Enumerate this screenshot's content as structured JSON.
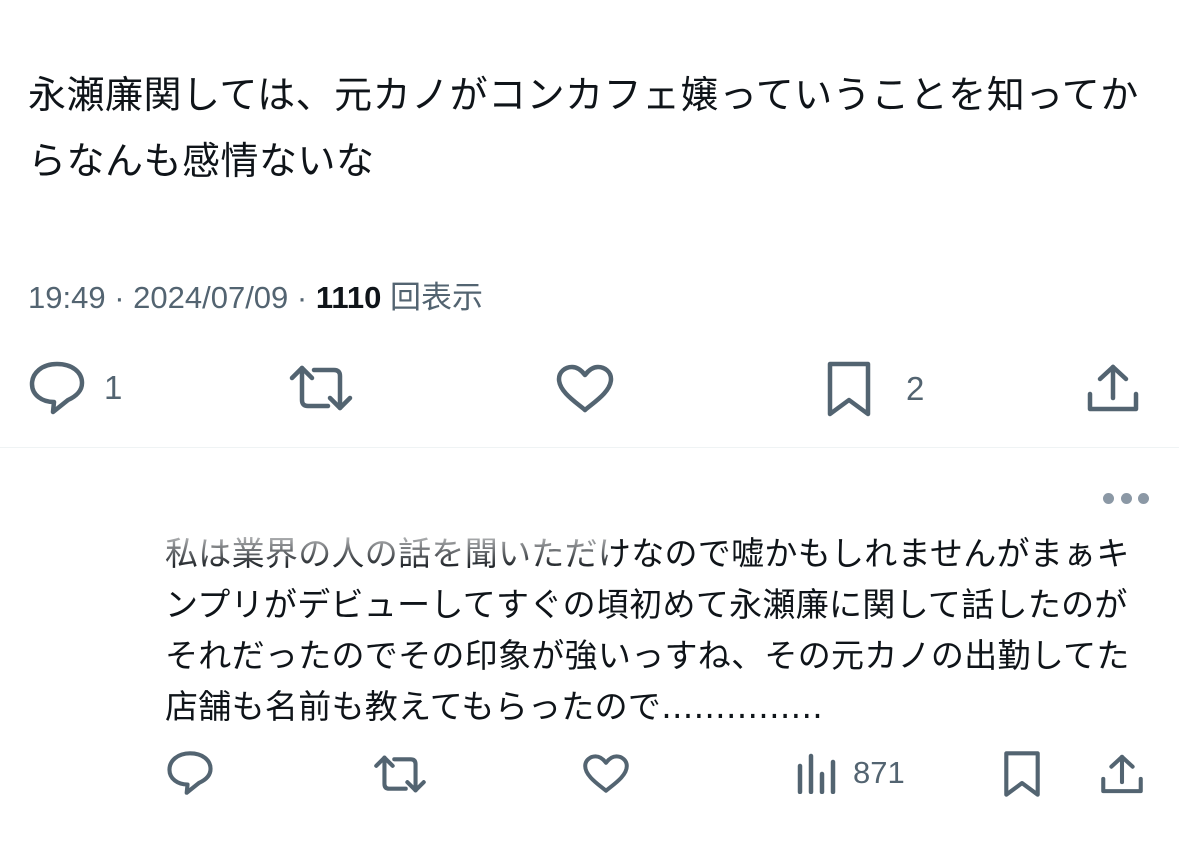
{
  "tweet": {
    "text": "永瀬廉関しては、元カノがコンカフェ嬢っていうことを知ってからなんも感情ないな",
    "time": "19:49",
    "date": "2024/07/09",
    "views_count": "1110",
    "views_label": "回表示",
    "actions": {
      "reply_count": "1",
      "bookmark_count": "2"
    }
  },
  "reply": {
    "text": "私は業界の人の話を聞いただけなので嘘かもしれませんがまぁキンプリがデビューしてすぐの頃初めて永瀬廉に関して話したのがそれだったのでその印象が強いっすね、その元カノの出勤してた店舗も名前も教えてもらったので...............",
    "actions": {
      "views_count": "871"
    }
  },
  "icons": {
    "reply": "speech-bubble-icon",
    "retweet": "retweet-icon",
    "like": "heart-icon",
    "bookmark": "bookmark-icon",
    "share": "share-icon",
    "views": "bar-chart-icon",
    "more": "more-icon"
  },
  "colors": {
    "icon": "#536471",
    "text": "#0f1419",
    "divider": "#eff3f4"
  }
}
